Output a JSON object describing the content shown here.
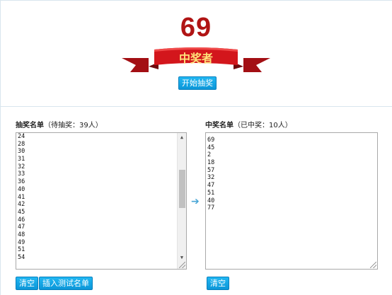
{
  "winner": {
    "number": "69",
    "ribbon_label": "中奖者",
    "start_button": "开始抽奖"
  },
  "pool": {
    "title": "抽奖名单",
    "count_text": "（待抽奖：39人）",
    "visible_items": [
      "24",
      "28",
      "30",
      "31",
      "32",
      "33",
      "36",
      "40",
      "41",
      "42",
      "45",
      "46",
      "47",
      "48",
      "49",
      "51",
      "54"
    ],
    "clear_button": "清空",
    "insert_test_button": "插入测试名单"
  },
  "winners": {
    "title": "中奖名单",
    "count_text": "（已中奖：10人）",
    "items": [
      "69",
      "45",
      "2",
      "18",
      "57",
      "32",
      "47",
      "51",
      "40",
      "77"
    ],
    "clear_button": "清空"
  },
  "icons": {
    "transfer_arrow": "arrow-right-icon"
  },
  "colors": {
    "number": "#b01414",
    "ribbon": "#c8141a",
    "ribbon_text": "#ffe27a",
    "button": "#12a8e8"
  }
}
